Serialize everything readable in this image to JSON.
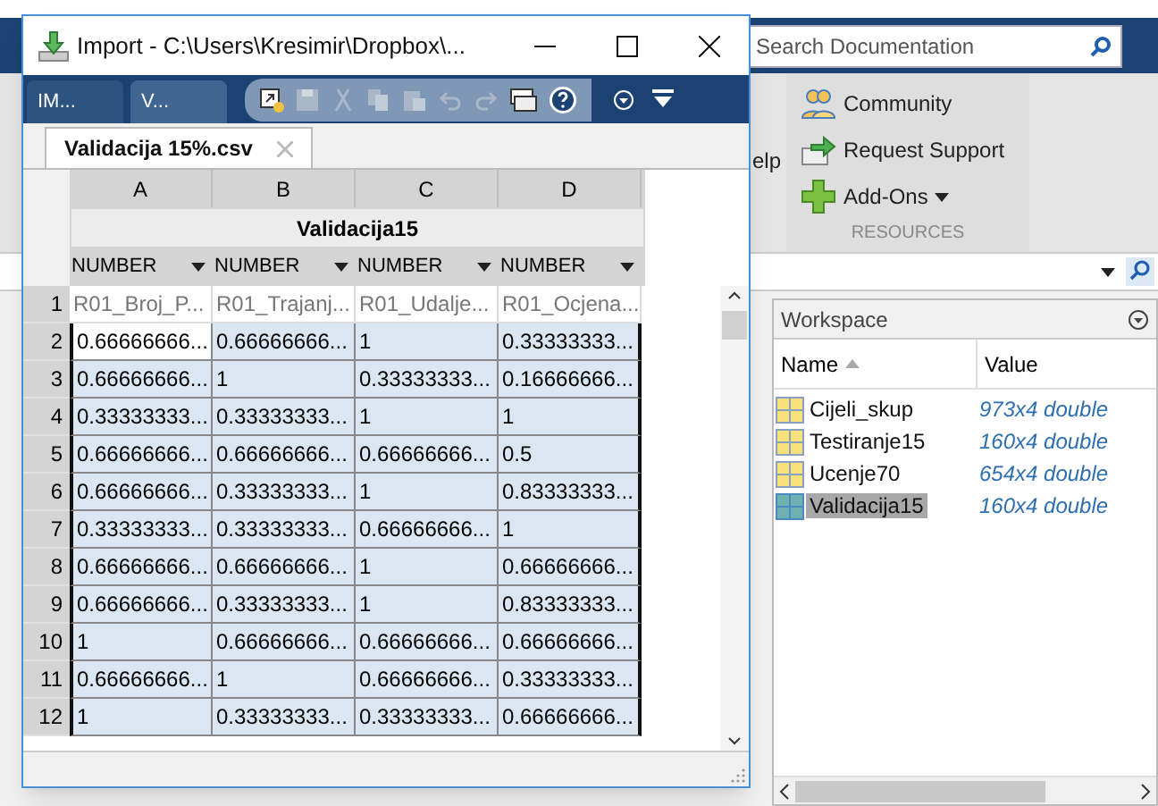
{
  "import_window": {
    "title": "Import - C:\\Users\\Kresimir\\Dropbox\\...",
    "tabs": [
      {
        "label": "IM...",
        "selected": false
      },
      {
        "label": "V...",
        "selected": true
      }
    ],
    "document_tab": "Validacija 15%.csv",
    "table": {
      "columns": [
        "A",
        "B",
        "C",
        "D"
      ],
      "group_header": "Validacija15",
      "types": [
        "NUMBER",
        "NUMBER",
        "NUMBER",
        "NUMBER"
      ],
      "rows": [
        {
          "number": "1",
          "selected": false,
          "cells": [
            {
              "text": "R01_Broj_P...",
              "active": false
            },
            {
              "text": "R01_Trajanj...",
              "active": false
            },
            {
              "text": "R01_Udalje...",
              "active": false
            },
            {
              "text": "R01_Ocjena...",
              "active": false
            }
          ]
        },
        {
          "number": "2",
          "selected": true,
          "cells": [
            {
              "text": "0.66666666...",
              "active": true
            },
            {
              "text": "0.66666666...",
              "active": false
            },
            {
              "text": "1",
              "active": false
            },
            {
              "text": "0.33333333...",
              "active": false
            }
          ]
        },
        {
          "number": "3",
          "selected": true,
          "cells": [
            {
              "text": "0.66666666...",
              "active": false
            },
            {
              "text": "1",
              "active": false
            },
            {
              "text": "0.33333333...",
              "active": false
            },
            {
              "text": "0.16666666...",
              "active": false
            }
          ]
        },
        {
          "number": "4",
          "selected": true,
          "cells": [
            {
              "text": "0.33333333...",
              "active": false
            },
            {
              "text": "0.33333333...",
              "active": false
            },
            {
              "text": "1",
              "active": false
            },
            {
              "text": "1",
              "active": false
            }
          ]
        },
        {
          "number": "5",
          "selected": true,
          "cells": [
            {
              "text": "0.66666666...",
              "active": false
            },
            {
              "text": "0.66666666...",
              "active": false
            },
            {
              "text": "0.66666666...",
              "active": false
            },
            {
              "text": "0.5",
              "active": false
            }
          ]
        },
        {
          "number": "6",
          "selected": true,
          "cells": [
            {
              "text": "0.66666666...",
              "active": false
            },
            {
              "text": "0.33333333...",
              "active": false
            },
            {
              "text": "1",
              "active": false
            },
            {
              "text": "0.83333333...",
              "active": false
            }
          ]
        },
        {
          "number": "7",
          "selected": true,
          "cells": [
            {
              "text": "0.33333333...",
              "active": false
            },
            {
              "text": "0.33333333...",
              "active": false
            },
            {
              "text": "0.66666666...",
              "active": false
            },
            {
              "text": "1",
              "active": false
            }
          ]
        },
        {
          "number": "8",
          "selected": true,
          "cells": [
            {
              "text": "0.66666666...",
              "active": false
            },
            {
              "text": "0.66666666...",
              "active": false
            },
            {
              "text": "1",
              "active": false
            },
            {
              "text": "0.66666666...",
              "active": false
            }
          ]
        },
        {
          "number": "9",
          "selected": true,
          "cells": [
            {
              "text": "0.66666666...",
              "active": false
            },
            {
              "text": "0.33333333...",
              "active": false
            },
            {
              "text": "1",
              "active": false
            },
            {
              "text": "0.83333333...",
              "active": false
            }
          ]
        },
        {
          "number": "10",
          "selected": true,
          "cells": [
            {
              "text": "1",
              "active": false
            },
            {
              "text": "0.66666666...",
              "active": false
            },
            {
              "text": "0.66666666...",
              "active": false
            },
            {
              "text": "0.66666666...",
              "active": false
            }
          ]
        },
        {
          "number": "11",
          "selected": true,
          "cells": [
            {
              "text": "0.66666666...",
              "active": false
            },
            {
              "text": "1",
              "active": false
            },
            {
              "text": "0.66666666...",
              "active": false
            },
            {
              "text": "0.33333333...",
              "active": false
            }
          ]
        },
        {
          "number": "12",
          "selected": true,
          "cells": [
            {
              "text": "1",
              "active": false
            },
            {
              "text": "0.33333333...",
              "active": false
            },
            {
              "text": "0.33333333...",
              "active": false
            },
            {
              "text": "0.66666666...",
              "active": false
            }
          ]
        }
      ]
    }
  },
  "main_window": {
    "search": {
      "placeholder": "Search Documentation"
    },
    "help_label": "elp",
    "resources": [
      {
        "label": "Community",
        "kind": "community",
        "dropdown": false
      },
      {
        "label": "Request Support",
        "kind": "support",
        "dropdown": false
      },
      {
        "label": "Add-Ons",
        "kind": "addons",
        "dropdown": true
      }
    ],
    "section_label": "RESOURCES",
    "workspace": {
      "title": "Workspace",
      "columns": [
        "Name",
        "Value"
      ],
      "variables": [
        {
          "name": "Cijeli_skup",
          "value": "973x4 double",
          "selected": false
        },
        {
          "name": "Testiranje15",
          "value": "160x4 double",
          "selected": false
        },
        {
          "name": "Ucenje70",
          "value": "654x4 double",
          "selected": false
        },
        {
          "name": "Validacija15",
          "value": "160x4 double",
          "selected": true
        }
      ]
    }
  }
}
